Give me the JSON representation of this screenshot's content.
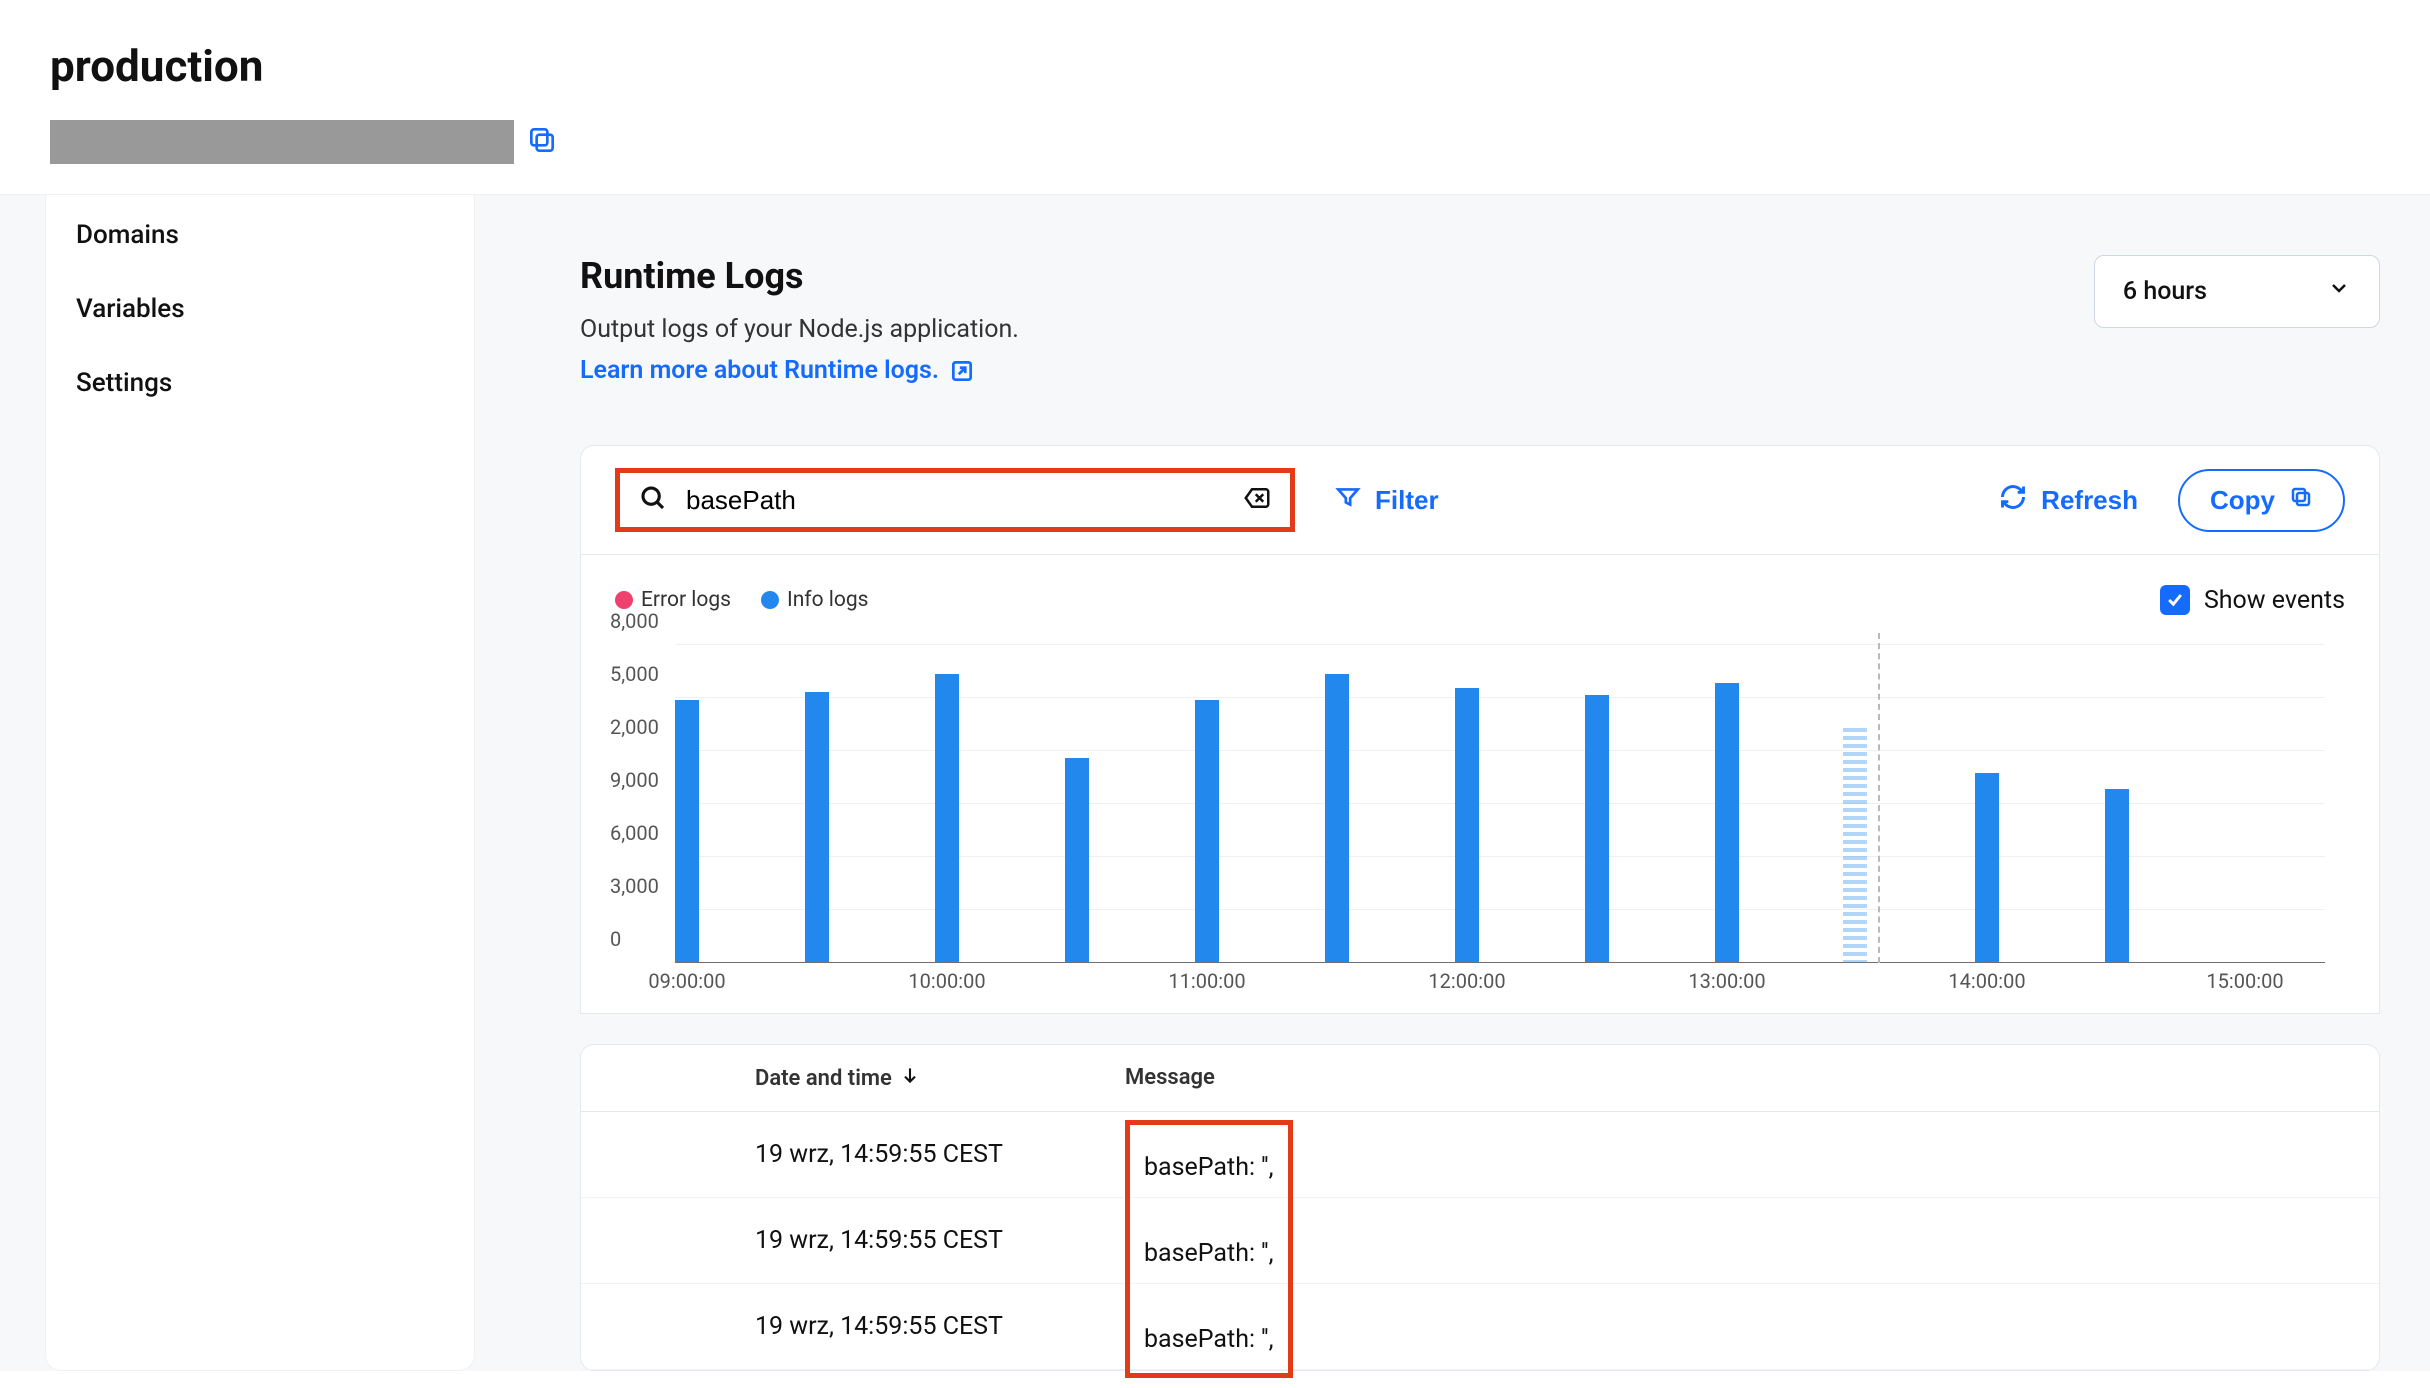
{
  "header": {
    "title": "production"
  },
  "sidebar": {
    "items": [
      "Domains",
      "Variables",
      "Settings"
    ]
  },
  "section": {
    "title": "Runtime Logs",
    "desc": "Output logs of your Node.js application.",
    "learn_more": "Learn more about Runtime logs."
  },
  "range_dropdown": {
    "label": "6 hours"
  },
  "toolbar": {
    "search_value": "basePath",
    "filter_label": "Filter",
    "refresh_label": "Refresh",
    "copy_label": "Copy"
  },
  "legend": {
    "error": "Error logs",
    "info": "Info logs",
    "show_events": "Show events"
  },
  "table": {
    "header_date": "Date and time",
    "header_message": "Message",
    "rows": [
      {
        "date": "19 wrz, 14:59:55 CEST",
        "message": "basePath: '',"
      },
      {
        "date": "19 wrz, 14:59:55 CEST",
        "message": "basePath: '',"
      },
      {
        "date": "19 wrz, 14:59:55 CEST",
        "message": "basePath: '',"
      }
    ]
  },
  "chart_data": {
    "type": "bar",
    "title": "",
    "xlabel": "",
    "ylabel": "",
    "y_ticks": [
      "0",
      "3,000",
      "6,000",
      "9,000",
      "2,000",
      "5,000",
      "8,000"
    ],
    "x_ticks": [
      "09:00:00",
      "10:00:00",
      "11:00:00",
      "12:00:00",
      "13:00:00",
      "14:00:00",
      "15:00:00"
    ],
    "series": [
      {
        "name": "Info logs",
        "color": "#2388ee",
        "x": [
          "09:00",
          "09:30",
          "10:00",
          "10:30",
          "11:00",
          "11:30",
          "12:00",
          "12:30",
          "13:00",
          "13:30",
          "14:00",
          "14:30"
        ],
        "values": [
          14500,
          15000,
          16000,
          11300,
          14500,
          16000,
          15200,
          14800,
          15500,
          13000,
          10500,
          9600
        ]
      }
    ],
    "ylim_note": "Axis ticks as shown on screen are non-monotonic (rendered verbatim).",
    "event_marker_x": "13:40",
    "latest_bar_style": "dashed"
  }
}
